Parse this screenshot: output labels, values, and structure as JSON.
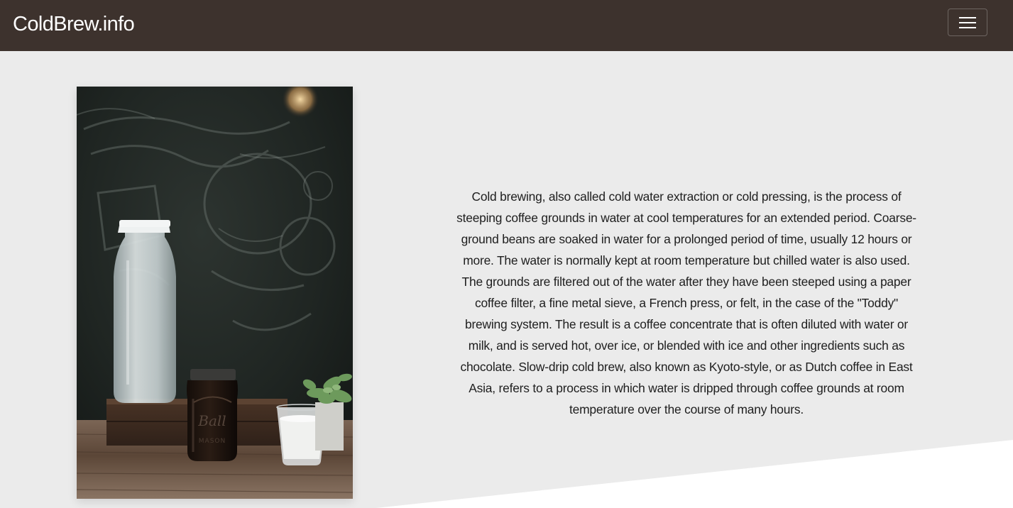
{
  "navbar": {
    "brand": "ColdBrew.info",
    "menu_icon": "hamburger-menu-icon"
  },
  "hero": {
    "image_alt": "Cold brew coffee in a mason jar next to a water carafe, a glass of milk and a succulent plant on a wooden table",
    "jar_label": "Ball MASON",
    "description": "Cold brewing, also called cold water extraction or cold pressing, is the process of steeping coffee grounds in water at cool temperatures for an extended period. Coarse-ground beans are soaked in water for a prolonged period of time, usually 12 hours or more. The water is normally kept at room temperature but chilled water is also used. The grounds are filtered out of the water after they have been steeped using a paper coffee filter, a fine metal sieve, a French press, or felt, in the case of the \"Toddy\" brewing system. The result is a coffee concentrate that is often diluted with water or milk, and is served hot, over ice, or blended with ice and other ingredients such as chocolate. Slow-drip cold brew, also known as Kyoto-style, or as Dutch coffee in East Asia, refers to a process in which water is dripped through coffee grounds at room temperature over the course of many hours."
  },
  "colors": {
    "navbar_bg": "#3d322d",
    "page_bg": "#ebebeb",
    "diagonal_bg": "#ffffff",
    "text": "#1e1e1e"
  }
}
